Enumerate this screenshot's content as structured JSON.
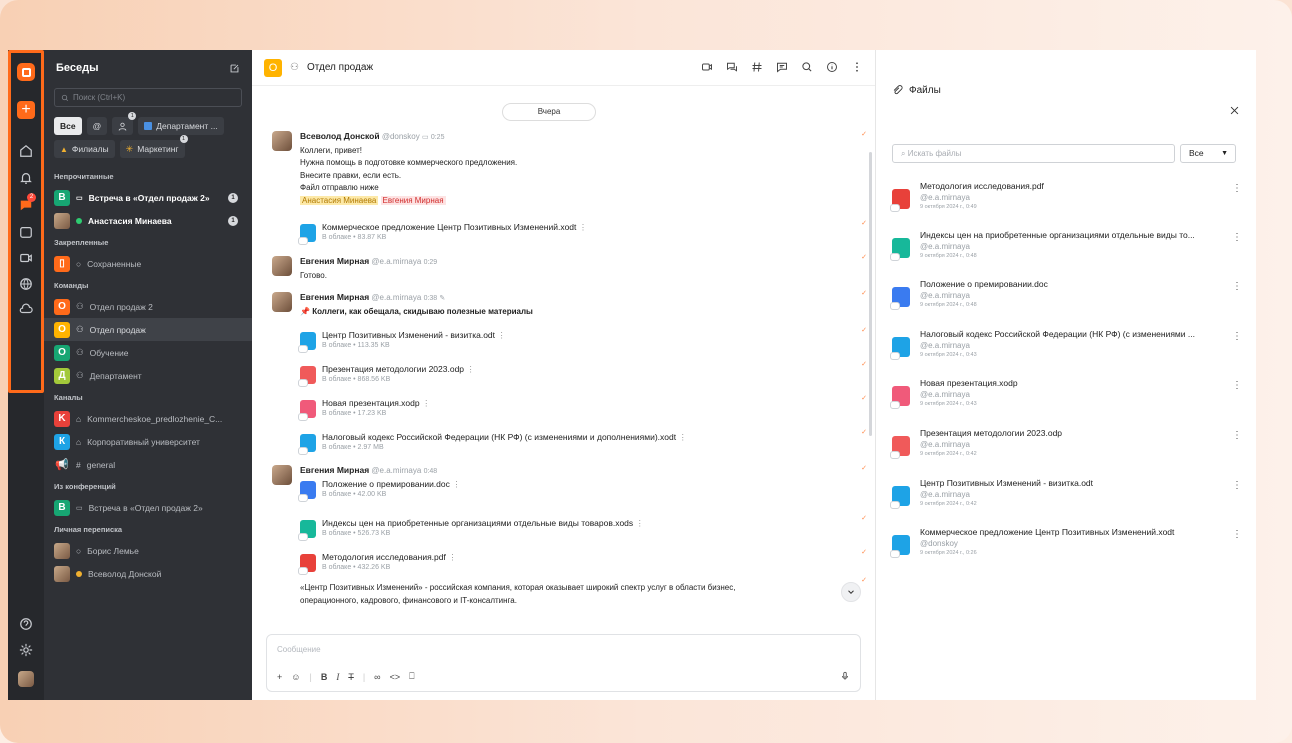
{
  "sidebar": {
    "title": "Беседы",
    "search_placeholder": "Поиск (Ctrl+K)",
    "chips": [
      {
        "label": "Все"
      },
      {
        "label": "@"
      },
      {
        "label": "",
        "badge": "1"
      },
      {
        "label": "Департамент ..."
      },
      {
        "label": "Филиалы"
      },
      {
        "label": "Маркетинг",
        "badge": "1"
      }
    ],
    "sections": {
      "unread": "Непрочитанные",
      "pinned": "Закрепленные",
      "teams": "Команды",
      "channels": "Каналы",
      "conf": "Из конференций",
      "direct": "Личная переписка"
    },
    "unread": [
      {
        "label": "Встреча в «Отдел продаж 2»",
        "letter": "B",
        "count": "1"
      },
      {
        "label": "Анастасия Минаева",
        "count": "1"
      }
    ],
    "pinned": [
      {
        "label": "Сохраненные"
      }
    ],
    "teams": [
      {
        "label": "Отдел продаж 2",
        "letter": "О"
      },
      {
        "label": "Отдел продаж",
        "letter": "О"
      },
      {
        "label": "Обучение",
        "letter": "О"
      },
      {
        "label": "Департамент",
        "letter": "Д"
      }
    ],
    "channels": [
      {
        "label": "Kommercheskoe_predlozhenie_C...",
        "letter": "K"
      },
      {
        "label": "Корпоративный университет",
        "letter": "К"
      },
      {
        "label": "general"
      }
    ],
    "conf": [
      {
        "label": "Встреча в «Отдел продаж 2»",
        "letter": "B"
      }
    ],
    "direct": [
      {
        "label": "Борис Лемье"
      },
      {
        "label": "Всеволод Донской"
      }
    ]
  },
  "rail": {
    "badge": "2"
  },
  "chat": {
    "title": "Отдел продаж",
    "avatar_letter": "О",
    "day": "Вчера",
    "m1": {
      "name": "Всеволод Донской",
      "user": "@donskoy",
      "time": "0:25",
      "l1": "Коллеги, привет!",
      "l2": "Нужна помощь в подготовке коммерческого предложения.",
      "l3": "Внесите правки, если есть.",
      "l4": "Файл отправлю ниже",
      "tag1": "Анастасия Минаева",
      "tag2": "Евгения Мирная"
    },
    "a1": {
      "name": "Коммерческое предложение Центр Позитивных Изменений.xodt",
      "sub": "В облаке • 83.87 KB"
    },
    "m2": {
      "name": "Евгения Мирная",
      "user": "@e.a.mirnaya",
      "time": "0:29",
      "text": "Готово."
    },
    "m3": {
      "name": "Евгения Мирная",
      "user": "@e.a.mirnaya",
      "time": "0:38",
      "text": "Коллеги, как обещала, скидываю полезные материалы"
    },
    "a2": {
      "name": "Центр Позитивных Изменений - визитка.odt",
      "sub": "В облаке • 113.35 KB"
    },
    "a3": {
      "name": "Презентация методологии 2023.odp",
      "sub": "В облаке • 868.56 KB"
    },
    "a4": {
      "name": "Новая презентация.xodp",
      "sub": "В облаке • 17.23 KB"
    },
    "a5": {
      "name": "Налоговый кодекс Российской Федерации (НК РФ) (с изменениями и дополнениями).xodt",
      "sub": "В облаке • 2.97 MB"
    },
    "m4": {
      "name": "Евгения Мирная",
      "user": "@e.a.mirnaya",
      "time": "0:48"
    },
    "a6": {
      "name": "Положение о премировании.doc",
      "sub": "В облаке • 42.00 KB"
    },
    "a7": {
      "name": "Индексы цен на приобретенные организациями отдельные виды товаров.xods",
      "sub": "В облаке • 526.73 KB"
    },
    "a8": {
      "name": "Методология исследования.pdf",
      "sub": "В облаке • 432.26 KB"
    },
    "para1": "«Центр Позитивных Изменений» - российская компания, которая оказывает широкий спектр услуг в области бизнес,",
    "para2": "операционного, кадрового, финансового и IT-консалтинга.",
    "compose_placeholder": "Сообщение"
  },
  "files": {
    "title": "Файлы",
    "search_placeholder": "Искать файлы",
    "filter": "Все",
    "items": [
      {
        "name": "Методология исследования.pdf",
        "user": "@e.a.mirnaya",
        "date": "9 октября 2024 г., 0:49"
      },
      {
        "name": "Индексы цен на приобретенные организациями отдельные виды то...",
        "user": "@e.a.mirnaya",
        "date": "9 октября 2024 г., 0:48"
      },
      {
        "name": "Положение о премировании.doc",
        "user": "@e.a.mirnaya",
        "date": "9 октября 2024 г., 0:48"
      },
      {
        "name": "Налоговый кодекс Российской Федерации (НК РФ) (с изменениями ...",
        "user": "@e.a.mirnaya",
        "date": "9 октября 2024 г., 0:43"
      },
      {
        "name": "Новая презентация.xodp",
        "user": "@e.a.mirnaya",
        "date": "9 октября 2024 г., 0:43"
      },
      {
        "name": "Презентация методологии 2023.odp",
        "user": "@e.a.mirnaya",
        "date": "9 октября 2024 г., 0:42"
      },
      {
        "name": "Центр Позитивных Изменений - визитка.odt",
        "user": "@e.a.mirnaya",
        "date": "9 октября 2024 г., 0:42"
      },
      {
        "name": "Коммерческое предложение Центр Позитивных Изменений.xodt",
        "user": "@donskoy",
        "date": "9 октября 2024 г., 0:26"
      }
    ]
  },
  "colors": {
    "accent": "#ff6a1a",
    "sidebar": "#2f3136",
    "rail": "#26282c"
  }
}
